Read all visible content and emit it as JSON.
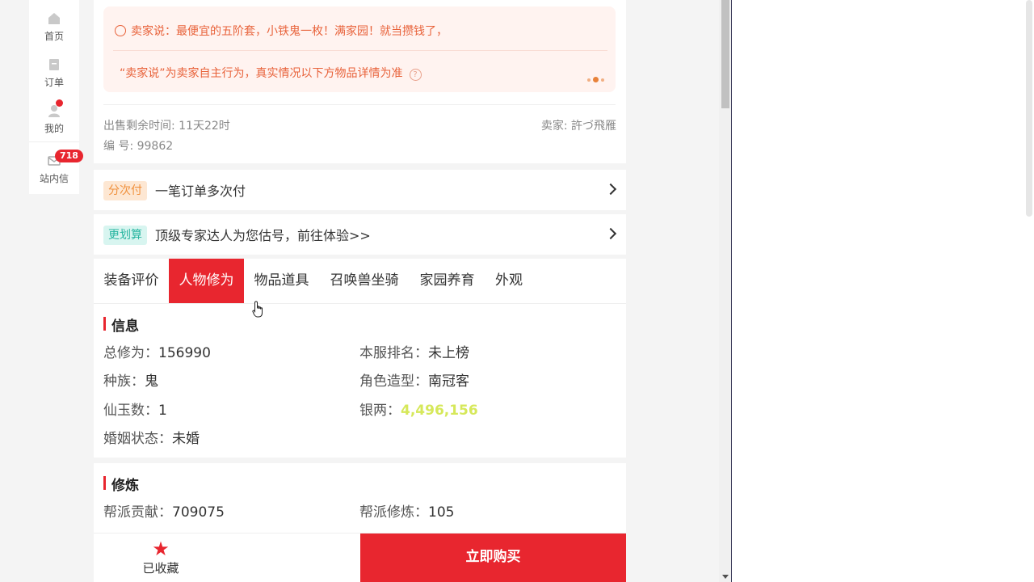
{
  "sidenav": {
    "items": [
      {
        "label": "首页",
        "icon": "home-icon"
      },
      {
        "label": "订单",
        "icon": "order-icon"
      },
      {
        "label": "我的",
        "icon": "user-icon"
      },
      {
        "label": "站内信",
        "icon": "mail-icon",
        "badge": "718"
      }
    ]
  },
  "seller_note": {
    "message": "卖家说：最便宜的五阶套，小铁鬼一枚！满家园！就当攒钱了，",
    "disclaimer": "“卖家说”为卖家自主行为，真实情况以下方物品详情为准",
    "help": "?"
  },
  "meta": {
    "remaining_time": "出售剩余时间: 11天22时",
    "serial": "编 号: 99862",
    "seller": "卖家: 許づ飛雁"
  },
  "installment": {
    "tag": "分次付",
    "text": "一笔订单多次付"
  },
  "appraisal": {
    "tag": "更划算",
    "text": "顶级专家达人为您估号，前往体验>>"
  },
  "tabs": [
    "装备评价",
    "人物修为",
    "物品道具",
    "召唤兽坐骑",
    "家园养育",
    "外观"
  ],
  "active_tab": "人物修为",
  "info": {
    "title": "信息",
    "total_cultivation": {
      "label": "总修为：",
      "value": "156990"
    },
    "server_rank": {
      "label": "本服排名：",
      "value": "未上榜"
    },
    "race": {
      "label": "种族：",
      "value": "鬼"
    },
    "role_model": {
      "label": "角色造型：",
      "value": "南冠客"
    },
    "jade": {
      "label": "仙玉数：",
      "value": "1"
    },
    "silver": {
      "label": "银两：",
      "value": "4,496,156"
    },
    "marriage": {
      "label": "婚姻状态：",
      "value": "未婚"
    }
  },
  "cultivation": {
    "title": "修炼",
    "guild_contribution": {
      "label": "帮派贡献：",
      "value": "709075"
    },
    "guild_training": {
      "label": "帮派修炼：",
      "value": "105"
    }
  },
  "bottom": {
    "favorite": "已收藏",
    "buy": "立即购买"
  },
  "colors": {
    "accent": "#e8262f",
    "seller_text": "#e8623a",
    "silver": "#d6e85a"
  }
}
